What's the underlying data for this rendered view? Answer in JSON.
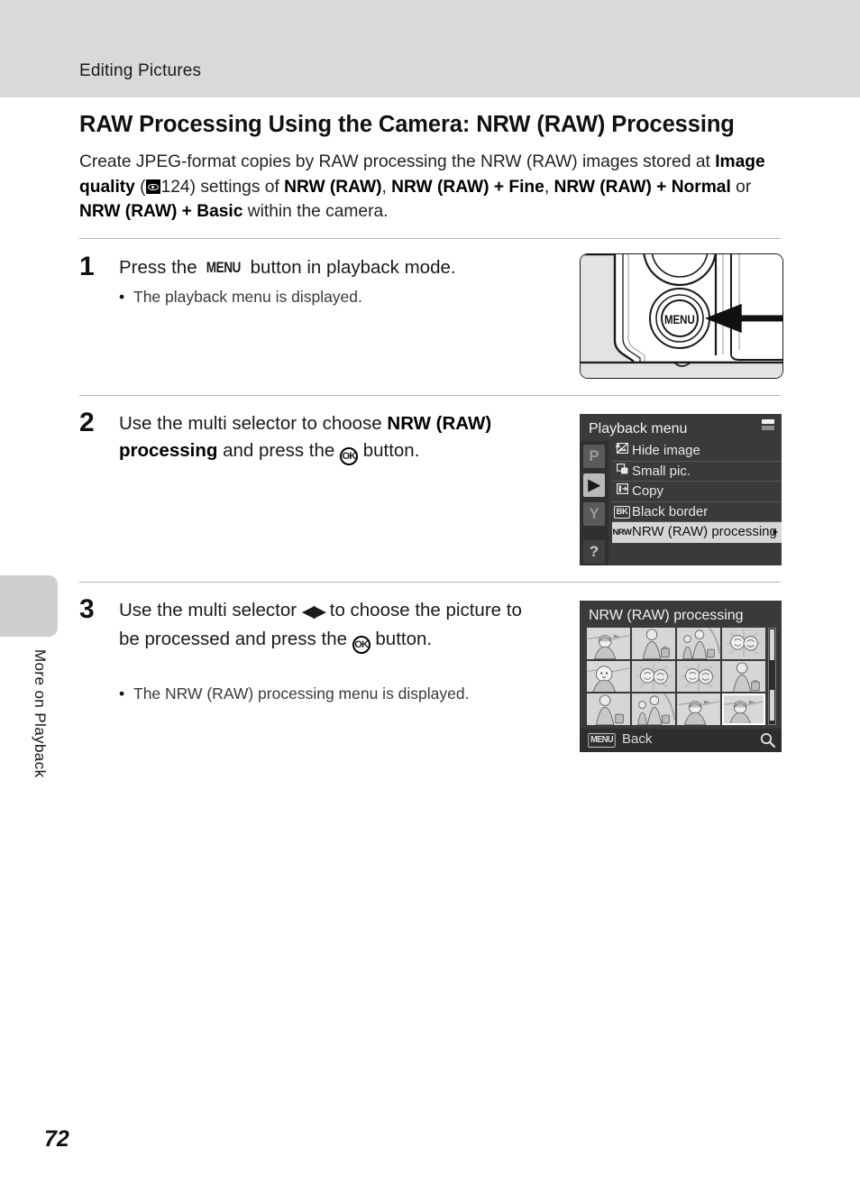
{
  "header": {
    "section_title": "Editing Pictures"
  },
  "side_tab": {
    "label": "More on Playback"
  },
  "page": {
    "title": "RAW Processing Using the Camera: NRW (RAW) Processing",
    "number": "72",
    "intro_part1": "Create JPEG-format copies by RAW processing the NRW (RAW) images stored at ",
    "intro_image_quality": "Image quality",
    "intro_ref_page": "124",
    "intro_part2": ") settings of ",
    "intro_opt1": "NRW (RAW)",
    "intro_sep1": ", ",
    "intro_opt2": "NRW (RAW) + Fine",
    "intro_sep2": ", ",
    "intro_opt3": "NRW (RAW) + Normal",
    "intro_sep3": " or ",
    "intro_opt4": "NRW (RAW) + Basic",
    "intro_part3": " within the camera."
  },
  "steps": [
    {
      "number": "1",
      "text_before": "Press the ",
      "glyph": "MENU",
      "text_after": " button in playback mode.",
      "bullet": "The playback menu is displayed."
    },
    {
      "number": "2",
      "text_a": "Use the multi selector to choose ",
      "bold_a": "NRW (RAW) processing",
      "text_b": " and press the ",
      "glyph": "OK",
      "text_c": " button."
    },
    {
      "number": "3",
      "text_a": "Use the multi selector ",
      "glyph_lr": "◀▶",
      "text_b": " to choose the picture to be processed and press the ",
      "glyph_ok": "OK",
      "text_c": " button.",
      "bullet": "The NRW (RAW) processing menu is displayed."
    }
  ],
  "camera_illustration": {
    "button_label": "MENU"
  },
  "playback_menu_screen": {
    "title": "Playback menu",
    "tabs": [
      {
        "name": "shooting-mode-tab",
        "glyph": "P",
        "selected": false
      },
      {
        "name": "playback-tab",
        "glyph": "▶",
        "selected": true
      },
      {
        "name": "setup-tab",
        "glyph": "Y",
        "selected": false
      },
      {
        "name": "help-tab",
        "glyph": "?",
        "selected": false
      }
    ],
    "items": [
      {
        "icon": "hide-image-icon",
        "icon_text": "◩",
        "label": "Hide image",
        "selected": false,
        "arrow": ""
      },
      {
        "icon": "small-picture-icon",
        "icon_text": "◲",
        "label": "Small pic.",
        "selected": false,
        "arrow": ""
      },
      {
        "icon": "copy-icon",
        "icon_text": "⇥",
        "label": "Copy",
        "selected": false,
        "arrow": ""
      },
      {
        "icon": "black-border-icon",
        "icon_text": "BK",
        "label": "Black border",
        "selected": false,
        "arrow": ""
      },
      {
        "icon": "nrw-icon",
        "icon_text": "NRW",
        "label": "NRW (RAW) processing",
        "selected": true,
        "arrow": "▸"
      }
    ]
  },
  "thumbnail_screen": {
    "title": "NRW (RAW) processing",
    "back_badge": "MENU",
    "back_label": "Back",
    "zoom_icon": "magnifier-icon",
    "thumbnails": [
      {
        "type": "woman-landscape",
        "selected": false
      },
      {
        "type": "woman-bag",
        "selected": false
      },
      {
        "type": "family-two",
        "selected": false
      },
      {
        "type": "flowers",
        "selected": false
      },
      {
        "type": "woman-landscape",
        "selected": false
      },
      {
        "type": "flowers",
        "selected": false
      },
      {
        "type": "flowers",
        "selected": false
      },
      {
        "type": "woman-bag",
        "selected": false
      },
      {
        "type": "woman-bag",
        "selected": false
      },
      {
        "type": "family-two",
        "selected": false
      },
      {
        "type": "woman-landscape",
        "selected": false
      },
      {
        "type": "woman-landscape",
        "selected": true
      }
    ]
  },
  "colors": {
    "header_band": "#d9d9d9",
    "side_tab": "#cfcfcf",
    "lcd_background": "#3a3a3c",
    "lcd_highlight": "#d6d6d6",
    "separator": "#b4b4b4"
  }
}
